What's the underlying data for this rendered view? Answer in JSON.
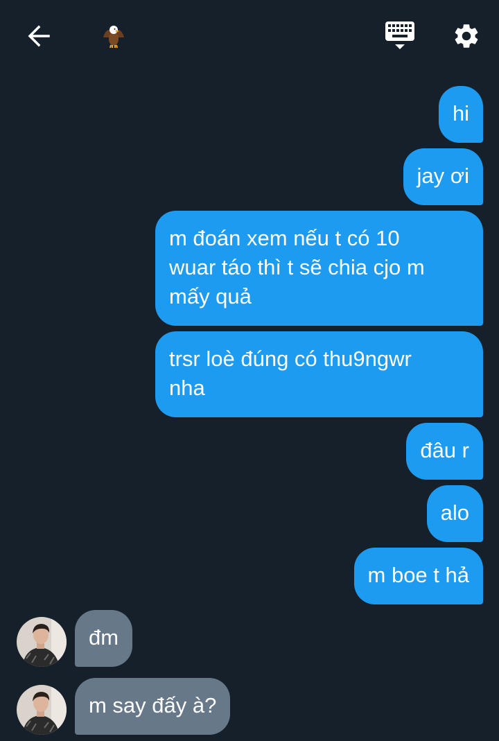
{
  "header": {
    "back_icon": "arrow-left-icon",
    "conversation_emoji": "🦅",
    "keyboard_icon": "keyboard-icon",
    "settings_icon": "gear-icon"
  },
  "colors": {
    "background": "#15202b",
    "outgoing_bubble": "#1d9bf0",
    "incoming_bubble": "#677889",
    "text": "#ffffff"
  },
  "messages": [
    {
      "direction": "outgoing",
      "text": "hi"
    },
    {
      "direction": "outgoing",
      "text": "jay ơi"
    },
    {
      "direction": "outgoing",
      "lines": [
        "m đoán xem nếu t có 10",
        "wuar táo thì t sẽ chia cjo m",
        "mấy quả"
      ]
    },
    {
      "direction": "outgoing",
      "lines": [
        "trsr loè đúng có thu9ngwr",
        "nha"
      ]
    },
    {
      "direction": "outgoing",
      "text": "đâu r"
    },
    {
      "direction": "outgoing",
      "text": "alo"
    },
    {
      "direction": "outgoing",
      "text": "m boe t hả"
    },
    {
      "direction": "incoming",
      "text": "đm",
      "avatar": "user-avatar"
    },
    {
      "direction": "incoming",
      "text": "m say đấy à?",
      "avatar": "user-avatar"
    }
  ]
}
